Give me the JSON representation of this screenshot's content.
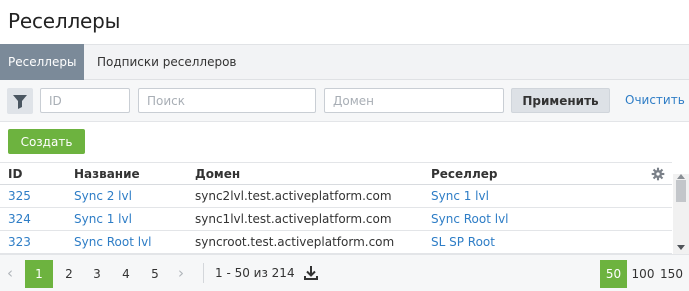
{
  "page": {
    "title": "Реселлеры"
  },
  "tabs": [
    {
      "label": "Реселлеры",
      "active": true
    },
    {
      "label": "Подписки реселлеров",
      "active": false
    }
  ],
  "filters": {
    "id_placeholder": "ID",
    "search_placeholder": "Поиск",
    "domain_placeholder": "Домен",
    "apply_label": "Применить",
    "clear_label": "Очистить"
  },
  "toolbar": {
    "create_label": "Создать"
  },
  "table": {
    "columns": {
      "id": "ID",
      "name": "Название",
      "domain": "Домен",
      "reseller": "Реселлер"
    },
    "rows": [
      {
        "id": "325",
        "name": "Sync 2 lvl",
        "domain": "sync2lvl.test.activeplatform.com",
        "reseller": "Sync 1 lvl"
      },
      {
        "id": "324",
        "name": "Sync 1 lvl",
        "domain": "sync1lvl.test.activeplatform.com",
        "reseller": "Sync Root lvl"
      },
      {
        "id": "323",
        "name": "Sync Root lvl",
        "domain": "syncroot.test.activeplatform.com",
        "reseller": "SL SP Root"
      }
    ]
  },
  "pagination": {
    "pages": [
      "1",
      "2",
      "3",
      "4",
      "5"
    ],
    "current_page": "1",
    "range_text": "1 - 50 из 214",
    "page_sizes": [
      "50",
      "100",
      "150"
    ],
    "current_page_size": "50"
  },
  "colors": {
    "accent": "#6db33f",
    "link": "#2e7dc6",
    "active_tab": "#7b8a99"
  },
  "icons": {
    "filter": "filter-icon",
    "settings": "gear-icon",
    "download": "download-icon"
  }
}
